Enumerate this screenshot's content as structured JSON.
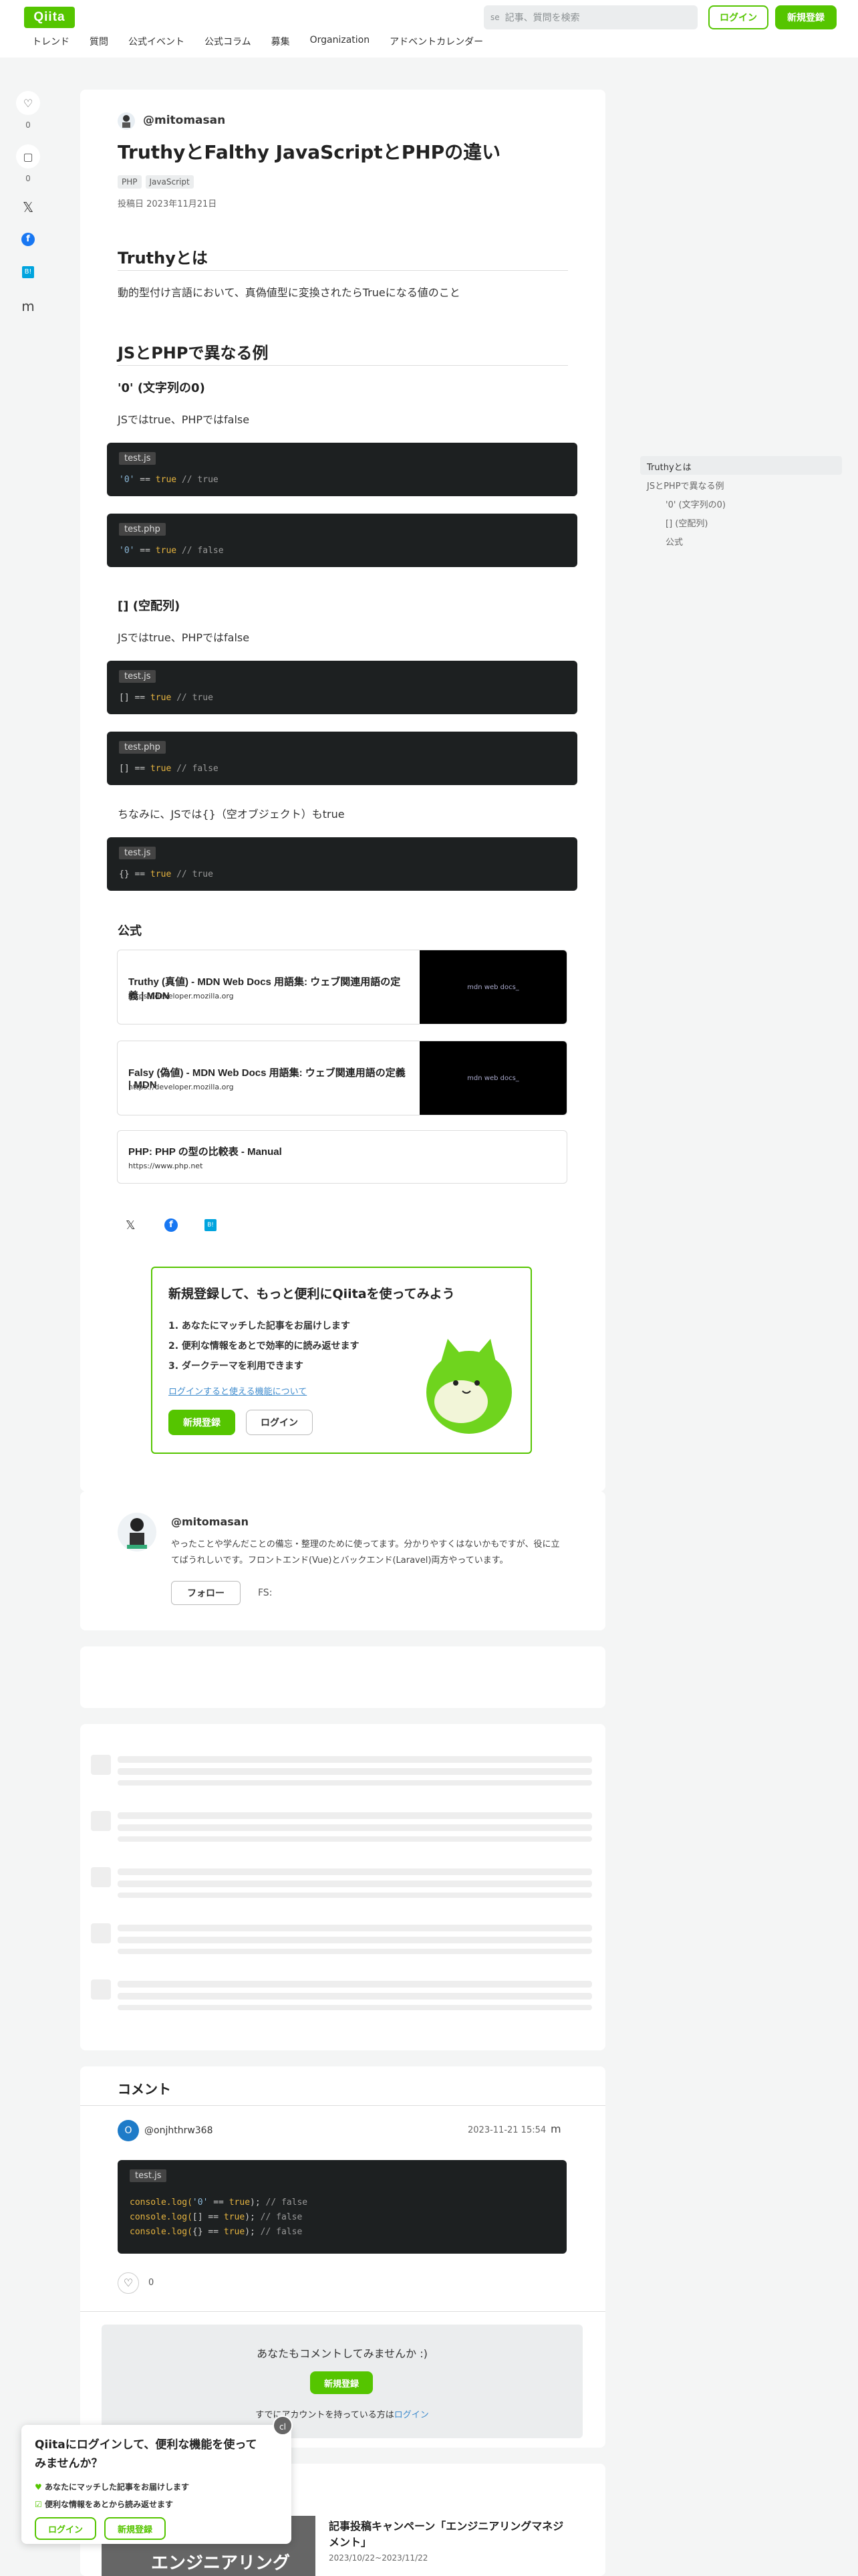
{
  "header": {
    "logo": "Qiita",
    "search_placeholder": "記事、質問を検索",
    "search_icon_text": "se",
    "login": "ログイン",
    "signup": "新規登録",
    "nav": [
      "トレンド",
      "質問",
      "公式イベント",
      "公式コラム",
      "募集",
      "Organization",
      "アドベントカレンダー"
    ]
  },
  "side_actions": {
    "like_count": "0",
    "stock_count": "0",
    "hatena": "m"
  },
  "article": {
    "author": "@mitomasan",
    "title": "TruthyとFalthy JavaScriptとPHPの違い",
    "tags": [
      "PHP",
      "JavaScript"
    ],
    "date": "投稿日 2023年11月21日",
    "s1_title": "Truthyとは",
    "s1_text": "動的型付け言語において、真偽値型に変換されたらTrueになる値のこと",
    "s2_title": "JSとPHPで異なる例",
    "s2a_title": "'0' (文字列の0)",
    "s2a_text": "JSではtrue、PHPではfalse",
    "code1": {
      "file": "test.js",
      "a": "'0'",
      "b": " == ",
      "c": "true",
      "d": " // true"
    },
    "code2": {
      "file": "test.php",
      "a": "'0'",
      "b": " == ",
      "c": "true",
      "d": " // false"
    },
    "s2b_title": "[] (空配列)",
    "s2b_text": "JSではtrue、PHPではfalse",
    "code3": {
      "file": "test.js",
      "a": "[]",
      "b": " == ",
      "c": "true",
      "d": " // true"
    },
    "code4": {
      "file": "test.php",
      "a": "[]",
      "b": " == ",
      "c": "true",
      "d": " // false"
    },
    "note": "ちなみに、JSでは{}（空オブジェクト）もtrue",
    "code5": {
      "file": "test.js",
      "a": "{}",
      "b": " == ",
      "c": "true",
      "d": " // true"
    },
    "s3_title": "公式",
    "links": [
      {
        "title": "Truthy (真値) - MDN Web Docs 用語集: ウェブ関連用語の定義 | MDN",
        "url": "https://developer.mozilla.org",
        "thumb": "mdn web docs_"
      },
      {
        "title": "Falsy (偽値) - MDN Web Docs 用語集: ウェブ関連用語の定義 | MDN",
        "url": "https://developer.mozilla.org",
        "thumb": "mdn web docs_"
      },
      {
        "title": "PHP: PHP の型の比較表 - Manual",
        "url": "https://www.php.net"
      }
    ]
  },
  "promo": {
    "title": "新規登録して、もっと便利にQiitaを使ってみよう",
    "items": [
      "1. あなたにマッチした記事をお届けします",
      "2. 便利な情報をあとで効率的に読み返せます",
      "3. ダークテーマを利用できます"
    ],
    "link": "ログインすると使える機能について",
    "signup": "新規登録",
    "login": "ログイン"
  },
  "author_card": {
    "name": "@mitomasan",
    "bio": "やったことや学んだことの備忘・整理のために使ってます。分かりやすくはないかもですが、役に立てばうれしいです。フロントエンド(Vue)とバックエンド(Laravel)両方やっています。",
    "follow": "フォロー",
    "extra": "FS:"
  },
  "comments": {
    "title": "コメント",
    "user": "@onjhthrw368",
    "avatar_letter": "O",
    "date": "2023-11-21 15:54",
    "menu": "m",
    "file": "test.js",
    "lines": [
      {
        "fn": "console.log(",
        "a": "'0'",
        "b": " == ",
        "c": "true",
        "e": ");",
        "d": " // false"
      },
      {
        "fn": "console.log(",
        "a": "[]",
        "b": " == ",
        "c": "true",
        "e": ");",
        "d": " // false"
      },
      {
        "fn": "console.log(",
        "a": "{}",
        "b": " == ",
        "c": "true",
        "e": ");",
        "d": " // false"
      }
    ],
    "like_count": "0",
    "cta": "あなたもコメントしてみませんか :)",
    "signup": "新規登録",
    "have_account": "すでにアカウントを持っている方は",
    "login_link": "ログイン"
  },
  "login_popup": {
    "title": "Qiitaにログインして、便利な機能を使ってみませんか？",
    "items": [
      "あなたにマッチした記事をお届けします",
      "便利な情報をあとから読み返せます"
    ],
    "login": "ログイン",
    "signup": "新規登録",
    "close_text": "cl"
  },
  "campaign": {
    "title": "記事投稿キャンペーン「エンジニアリングマネジメント」",
    "date": "2023/10/22~2023/11/22",
    "banner_text": "エンジニアリング"
  },
  "toc": [
    "Truthyとは",
    "JSとPHPで異なる例",
    "'0' (文字列の0)",
    "[] (空配列)",
    "公式"
  ],
  "colors": {
    "brand": "#55c500",
    "code_bg": "#1d2021"
  }
}
